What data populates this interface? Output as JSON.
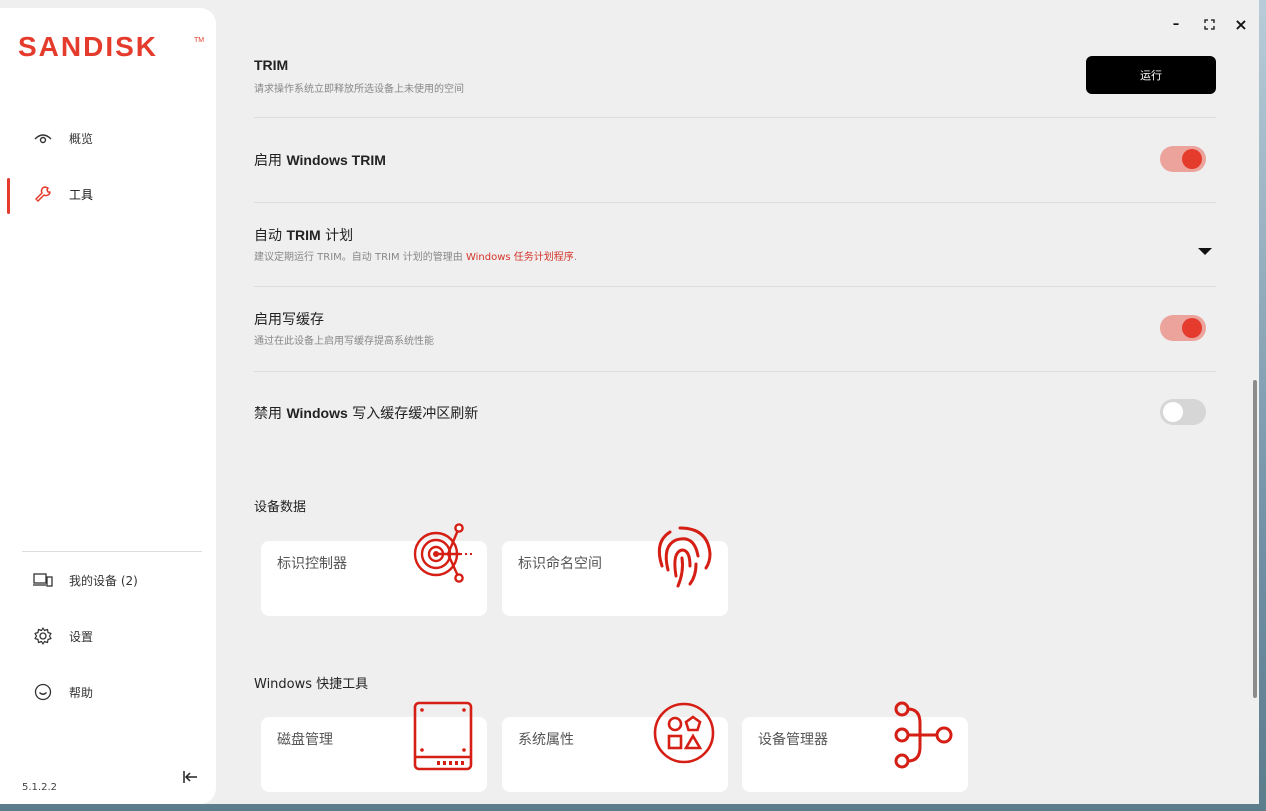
{
  "app": {
    "brand": "SANDISK",
    "trademark": "TM",
    "version": "5.1.2.2"
  },
  "window_controls": {
    "minimize": "–",
    "maximize": "⛶",
    "close": "×"
  },
  "sidebar": {
    "nav": [
      {
        "label": "概览",
        "icon": "eye-icon"
      },
      {
        "label": "工具",
        "icon": "wrench-icon",
        "active": true
      }
    ],
    "bottom": [
      {
        "label": "我的设备 (2)",
        "icon": "devices-icon"
      },
      {
        "label": "设置",
        "icon": "gear-icon"
      },
      {
        "label": "帮助",
        "icon": "help-icon"
      }
    ]
  },
  "trim": {
    "title": "TRIM",
    "subtitle": "请求操作系统立即释放所选设备上未使用的空间",
    "run_label": "运行"
  },
  "settings": {
    "enable_trim": {
      "prefix": "启用 ",
      "bold": "Windows TRIM",
      "suffix": "",
      "on": true
    },
    "auto_trim": {
      "prefix": "自动 ",
      "bold": "TRIM",
      "suffix": " 计划",
      "sub_text": "建议定期运行 TRIM。自动 TRIM 计划的管理由 ",
      "sub_link": "Windows 任务计划程序",
      "sub_end": "."
    },
    "write_cache": {
      "title": "启用写缓存",
      "subtitle": "通过在此设备上启用写缓存提高系统性能",
      "on": true
    },
    "disable_flush": {
      "prefix": "禁用 ",
      "bold": "Windows",
      "suffix": " 写入缓存缓冲区刷新",
      "on": false
    }
  },
  "device_data": {
    "title": "设备数据",
    "cards": [
      {
        "label": "标识控制器",
        "icon": "target-icon"
      },
      {
        "label": "标识命名空间",
        "icon": "fingerprint-icon"
      }
    ]
  },
  "windows_tools": {
    "title": "Windows 快捷工具",
    "cards": [
      {
        "label": "磁盘管理",
        "icon": "drive-icon"
      },
      {
        "label": "系统属性",
        "icon": "shapes-icon"
      },
      {
        "label": "设备管理器",
        "icon": "hierarchy-icon"
      }
    ]
  },
  "colors": {
    "accent": "#e43b2c",
    "accent_light": "#eba39c",
    "icon_red": "#d51e14"
  }
}
